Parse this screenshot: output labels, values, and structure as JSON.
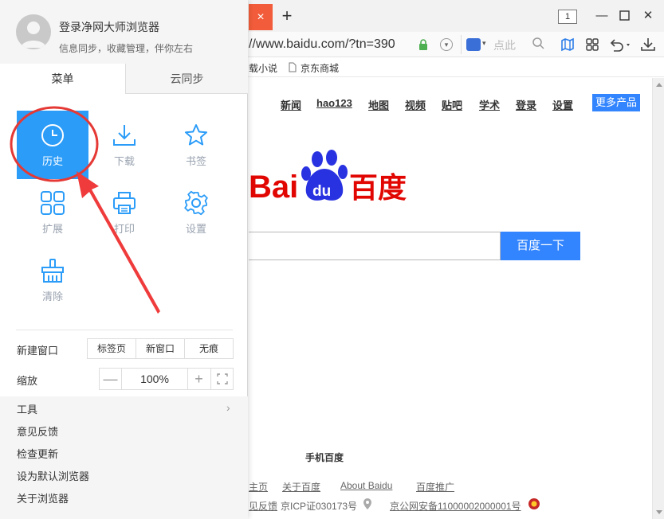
{
  "browser": {
    "tab_close": "×",
    "tab_new": "+",
    "tab_count": "1",
    "url": "//www.baidu.com/?tn=390",
    "search_placeholder": "点此",
    "favorites": [
      "载小说",
      "京东商城"
    ]
  },
  "menu": {
    "login_title": "登录净网大师浏览器",
    "login_subtitle": "信息同步，收藏管理，伴你左右",
    "tabs": [
      "菜单",
      "云同步"
    ],
    "tiles": [
      {
        "label": "历史",
        "icon": "clock-icon"
      },
      {
        "label": "下载",
        "icon": "download-icon"
      },
      {
        "label": "书签",
        "icon": "star-icon"
      },
      {
        "label": "扩展",
        "icon": "extensions-icon"
      },
      {
        "label": "打印",
        "icon": "printer-icon"
      },
      {
        "label": "设置",
        "icon": "gear-icon"
      },
      {
        "label": "清除",
        "icon": "broom-icon"
      }
    ],
    "new_window": {
      "label": "新建窗口",
      "options": [
        "标签页",
        "新窗口",
        "无痕"
      ]
    },
    "zoom": {
      "label": "缩放",
      "minus": "—",
      "value": "100%",
      "plus": "+"
    },
    "bottom_items": [
      "工具",
      "意见反馈",
      "检查更新",
      "设为默认浏览器",
      "关于浏览器"
    ],
    "tools_chevron": "›"
  },
  "baidu": {
    "nav": [
      "新闻",
      "hao123",
      "地图",
      "视频",
      "贴吧",
      "学术",
      "登录",
      "设置"
    ],
    "more_products": "更多产品",
    "search_button": "百度一下",
    "mobile_baidu": "手机百度",
    "footer_links": [
      "主页",
      "关于百度",
      "About Baidu",
      "百度推广"
    ],
    "footer_line2": [
      "见反馈",
      "京ICP证030173号",
      "京公网安备11000002000001号"
    ]
  },
  "colors": {
    "accent_blue": "#3385ff",
    "tile_selected": "#2b9cf8",
    "tab_close_red": "#f25c3a",
    "annotation_red": "#e53935"
  }
}
